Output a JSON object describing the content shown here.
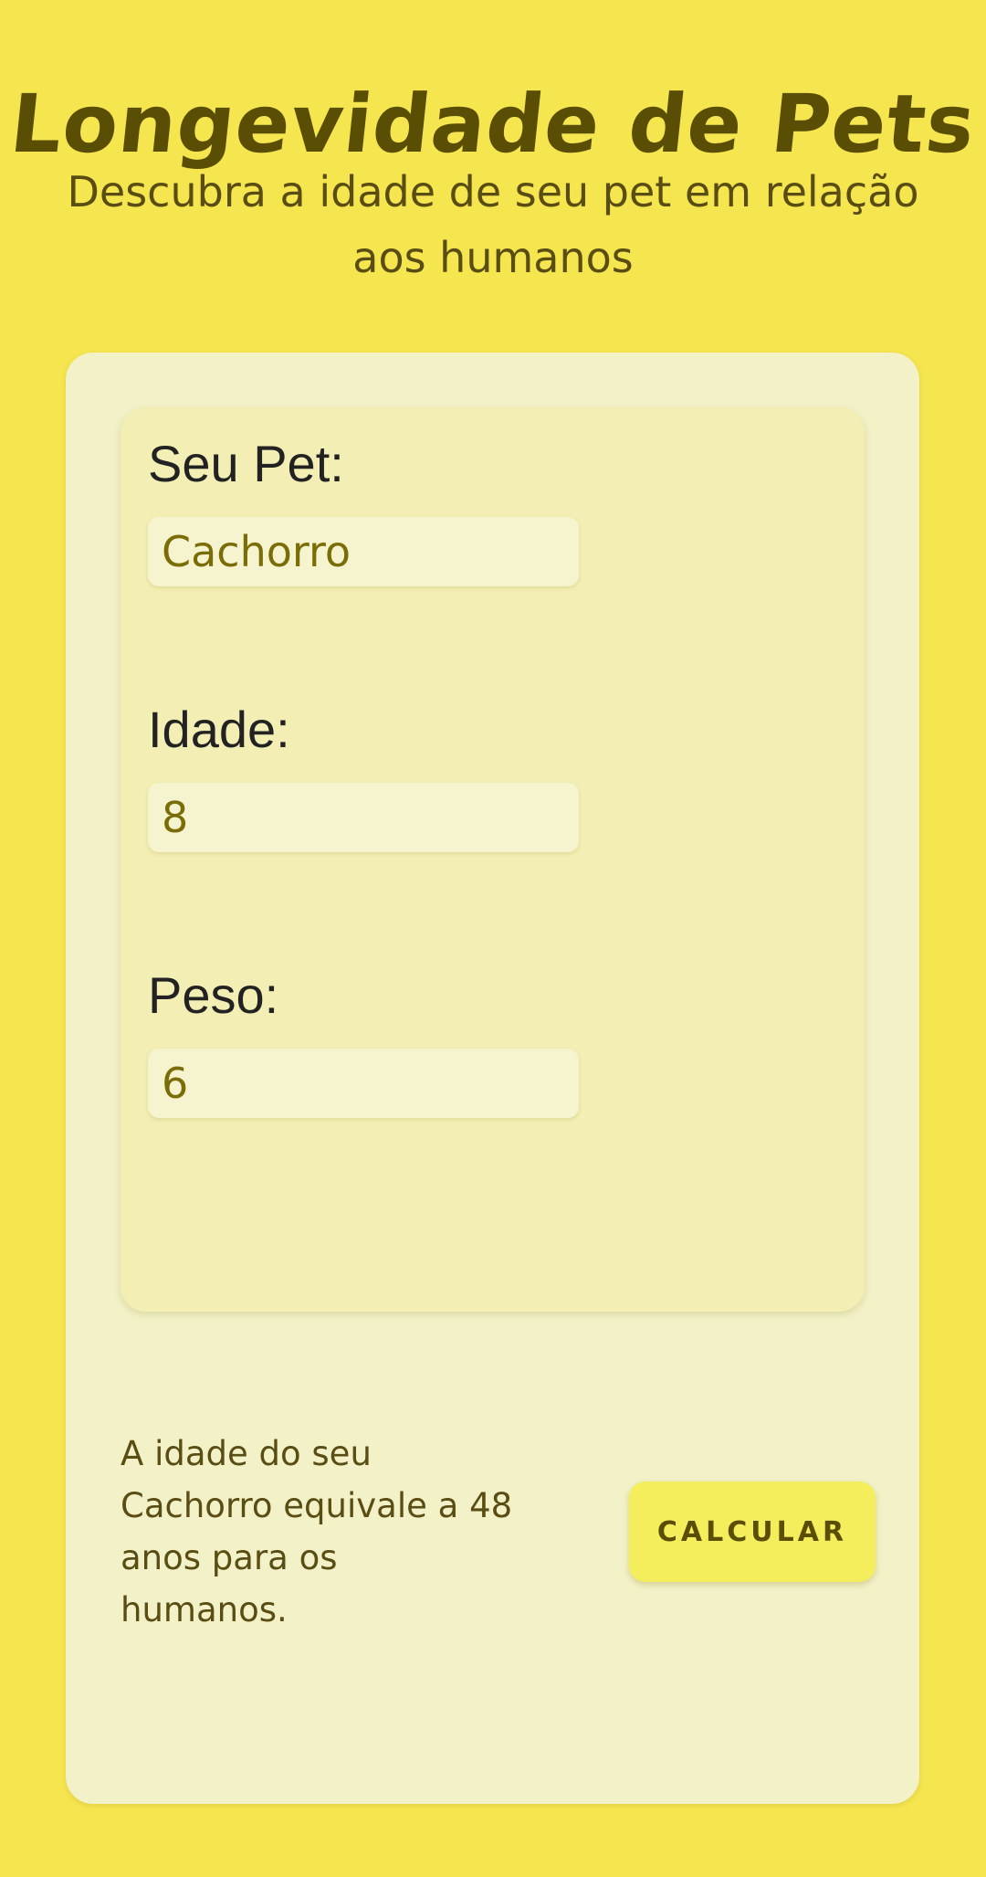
{
  "header": {
    "title": "Longevidade de Pets",
    "subtitle": "Descubra a idade de seu pet em relação aos humanos"
  },
  "form": {
    "pet": {
      "label": "Seu Pet:",
      "value": "Cachorro"
    },
    "age": {
      "label": "Idade:",
      "value": "8"
    },
    "weight": {
      "label": "Peso:",
      "value": "6"
    }
  },
  "result": {
    "text": "A idade do seu Cachorro equivale a 48 anos para os humanos."
  },
  "actions": {
    "calculate_label": "CALCULAR"
  },
  "colors": {
    "background": "#f5e54f",
    "card": "#f2f1c7",
    "form_panel": "#f3efb4",
    "title_text": "#5a4d04",
    "button": "#f4ee5d"
  }
}
